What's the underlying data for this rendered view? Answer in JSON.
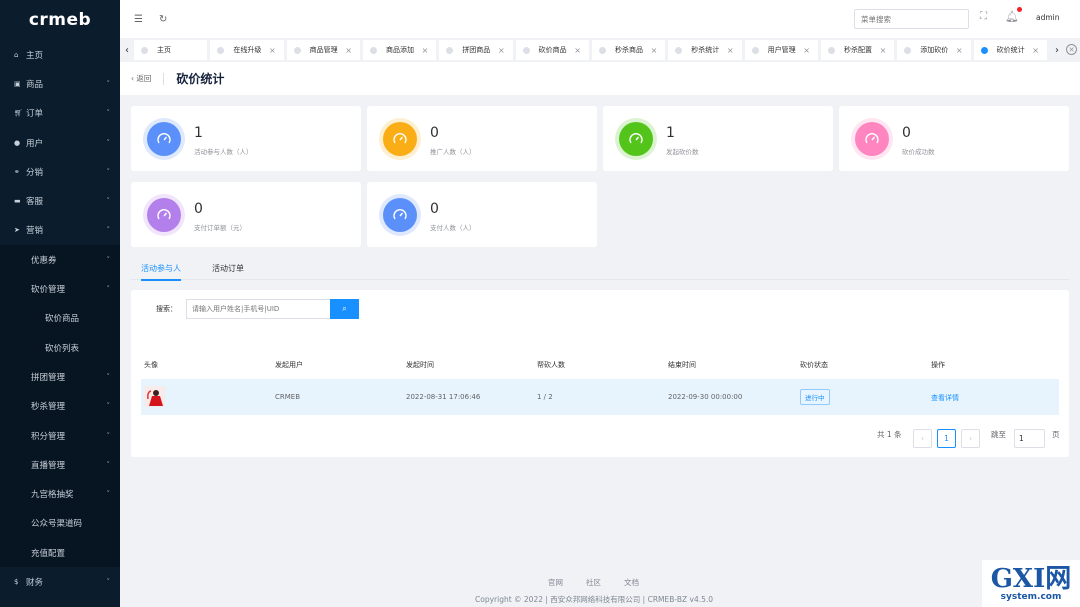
{
  "logo": "crmeb",
  "sidebar": {
    "items": [
      {
        "label": "主页",
        "icon": "home-icon",
        "chev": ""
      },
      {
        "label": "商品",
        "icon": "goods-icon",
        "chev": "⌄"
      },
      {
        "label": "订单",
        "icon": "cart-icon",
        "chev": "⌄"
      },
      {
        "label": "用户",
        "icon": "user-icon",
        "chev": "⌄"
      },
      {
        "label": "分销",
        "icon": "share-icon",
        "chev": "⌄"
      },
      {
        "label": "客服",
        "icon": "chat-icon",
        "chev": "⌄"
      },
      {
        "label": "营销",
        "icon": "send-icon",
        "chev": "⌃"
      },
      {
        "label": "优惠券",
        "level": 1,
        "chev": "⌄"
      },
      {
        "label": "砍价管理",
        "level": 1,
        "chev": "⌃"
      },
      {
        "label": "砍价商品",
        "level": 2,
        "chev": ""
      },
      {
        "label": "砍价列表",
        "level": 2,
        "chev": ""
      },
      {
        "label": "拼团管理",
        "level": 1,
        "chev": "⌄"
      },
      {
        "label": "秒杀管理",
        "level": 1,
        "chev": "⌄"
      },
      {
        "label": "积分管理",
        "level": 1,
        "chev": "⌄"
      },
      {
        "label": "直播管理",
        "level": 1,
        "chev": "⌄"
      },
      {
        "label": "九宫格抽奖",
        "level": 1,
        "chev": "⌄"
      },
      {
        "label": "公众号渠道码",
        "level": 1,
        "chev": ""
      },
      {
        "label": "充值配置",
        "level": 1,
        "chev": ""
      },
      {
        "label": "财务",
        "icon": "money-icon",
        "chev": "⌄"
      }
    ]
  },
  "header": {
    "search_placeholder": "菜单搜索",
    "user": "admin"
  },
  "tabs": [
    {
      "label": "主页",
      "closable": false
    },
    {
      "label": "在线升级",
      "closable": true
    },
    {
      "label": "商品管理",
      "closable": true
    },
    {
      "label": "商品添加",
      "closable": true
    },
    {
      "label": "拼团商品",
      "closable": true
    },
    {
      "label": "砍价商品",
      "closable": true
    },
    {
      "label": "秒杀商品",
      "closable": true
    },
    {
      "label": "秒杀统计",
      "closable": true
    },
    {
      "label": "用户管理",
      "closable": true
    },
    {
      "label": "秒杀配置",
      "closable": true
    },
    {
      "label": "添加砍价",
      "closable": true
    },
    {
      "label": "砍价统计",
      "closable": true,
      "active": true
    }
  ],
  "page": {
    "back": "返回",
    "title": "砍价统计"
  },
  "stats": [
    {
      "value": "1",
      "label": "活动参与人数（人）",
      "color": "#5b8ff9"
    },
    {
      "value": "0",
      "label": "推广人数（人）",
      "color": "#faad14"
    },
    {
      "value": "1",
      "label": "发起砍价数",
      "color": "#52c41a"
    },
    {
      "value": "0",
      "label": "砍价成功数",
      "color": "#ff85c0"
    },
    {
      "value": "0",
      "label": "支付订单额（元）",
      "color": "#b37feb"
    },
    {
      "value": "0",
      "label": "支付人数（人）",
      "color": "#5b8ff9"
    }
  ],
  "content_tabs": [
    "活动参与人",
    "活动订单"
  ],
  "search": {
    "label": "搜索：",
    "placeholder": "请输入用户姓名|手机号|UID"
  },
  "table": {
    "headers": [
      "头像",
      "发起用户",
      "发起时间",
      "帮砍人数",
      "结束时间",
      "砍价状态",
      "操作"
    ],
    "rows": [
      {
        "user": "CRMEB",
        "start": "2022-08-31 17:06:46",
        "helpers": "1 / 2",
        "end": "2022-09-30 00:00:00",
        "status": "进行中",
        "action": "查看详情"
      }
    ]
  },
  "pagination": {
    "total": "共 1 条",
    "current": "1",
    "goto_label": "跳至",
    "goto_value": "1",
    "page_unit": "页"
  },
  "footer": {
    "links": [
      "官网",
      "社区",
      "文档"
    ],
    "copyright": "Copyright © 2022 | 西安众邦网络科技有限公司 | CRMEB-BZ v4.5.0"
  },
  "watermark": {
    "big": "GXI网",
    "small": "system.com"
  }
}
